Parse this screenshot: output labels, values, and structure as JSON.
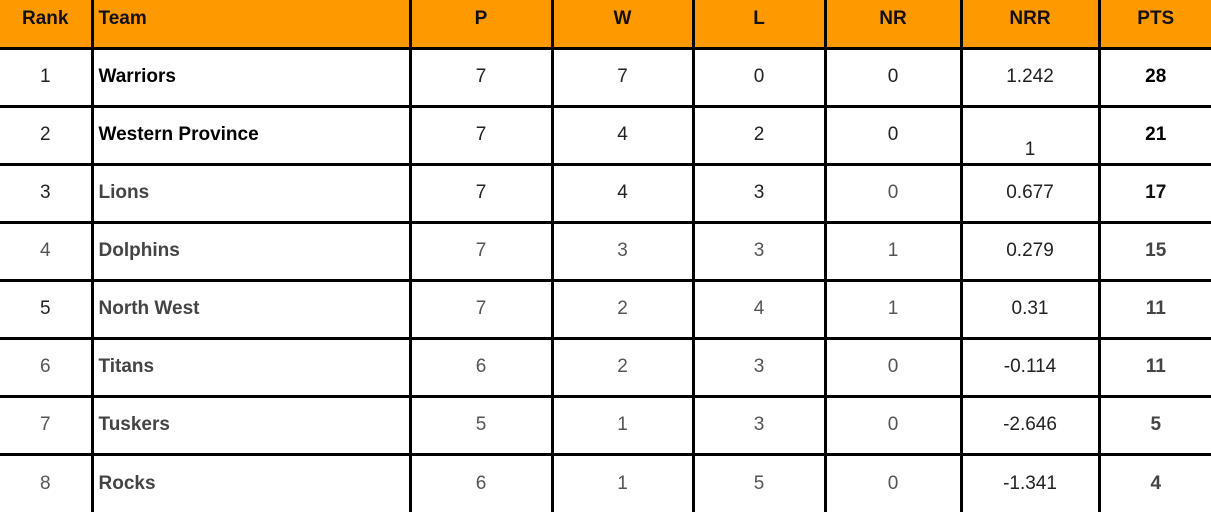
{
  "table": {
    "header_color": "#ff9900",
    "columns": [
      "Rank",
      "Team",
      "P",
      "W",
      "L",
      "NR",
      "NRR",
      "PTS"
    ],
    "rows": [
      {
        "rank": "1",
        "team": "Warriors",
        "p": "7",
        "w": "7",
        "l": "0",
        "nr": "0",
        "nrr": "1.242",
        "pts": "28"
      },
      {
        "rank": "2",
        "team": "Western Province",
        "p": "7",
        "w": "4",
        "l": "2",
        "nr": "0",
        "nrr": "1",
        "pts": "21"
      },
      {
        "rank": "3",
        "team": "Lions",
        "p": "7",
        "w": "4",
        "l": "3",
        "nr": "0",
        "nrr": "0.677",
        "pts": "17"
      },
      {
        "rank": "4",
        "team": "Dolphins",
        "p": "7",
        "w": "3",
        "l": "3",
        "nr": "1",
        "nrr": "0.279",
        "pts": "15"
      },
      {
        "rank": "5",
        "team": "North West",
        "p": "7",
        "w": "2",
        "l": "4",
        "nr": "1",
        "nrr": "0.31",
        "pts": "11"
      },
      {
        "rank": "6",
        "team": "Titans",
        "p": "6",
        "w": "2",
        "l": "3",
        "nr": "0",
        "nrr": "-0.114",
        "pts": "11"
      },
      {
        "rank": "7",
        "team": "Tuskers",
        "p": "5",
        "w": "1",
        "l": "3",
        "nr": "0",
        "nrr": "-2.646",
        "pts": "5"
      },
      {
        "rank": "8",
        "team": "Rocks",
        "p": "6",
        "w": "1",
        "l": "5",
        "nr": "0",
        "nrr": "-1.341",
        "pts": "4"
      }
    ]
  }
}
